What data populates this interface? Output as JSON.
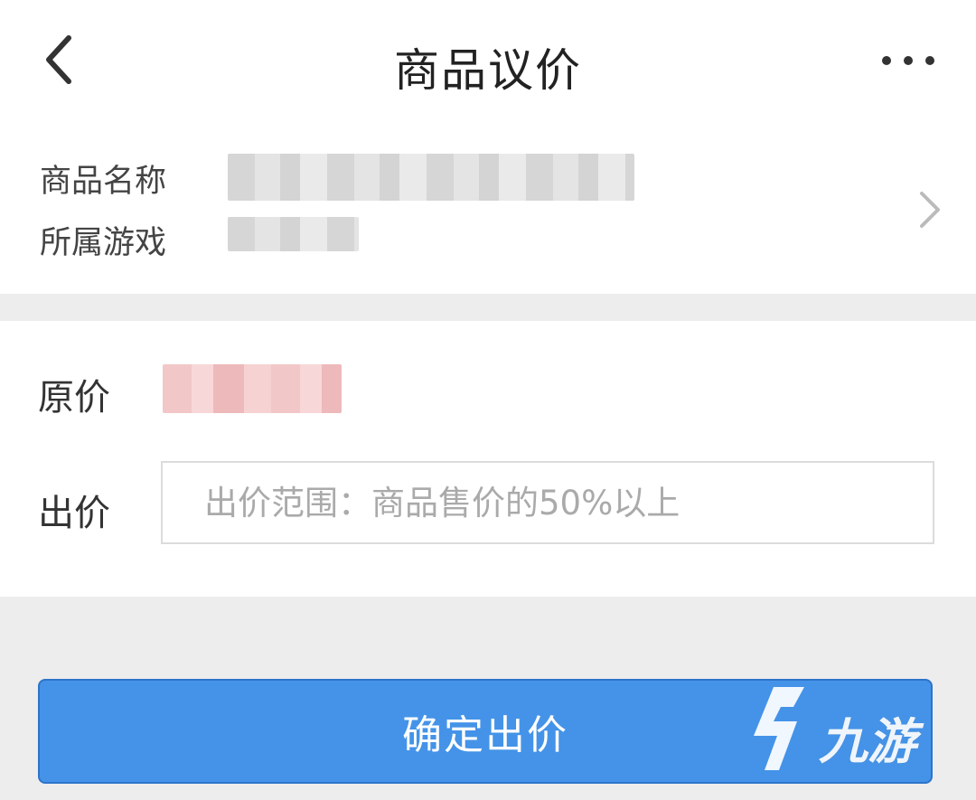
{
  "header": {
    "title": "商品议价",
    "back_icon": "chevron-left-icon",
    "more_icon": "more-horizontal-icon"
  },
  "product": {
    "name_label": "商品名称",
    "game_label": "所属游戏",
    "chevron_icon": "chevron-right-icon"
  },
  "pricing": {
    "original_label": "原价",
    "bid_label": "出价",
    "bid_placeholder": "出价范围：商品售价的50%以上",
    "bid_value": ""
  },
  "actions": {
    "confirm_label": "确定出价"
  },
  "watermark": {
    "text": "九游"
  },
  "colors": {
    "accent": "#4493e8",
    "background": "#ededed",
    "card": "#ffffff"
  }
}
